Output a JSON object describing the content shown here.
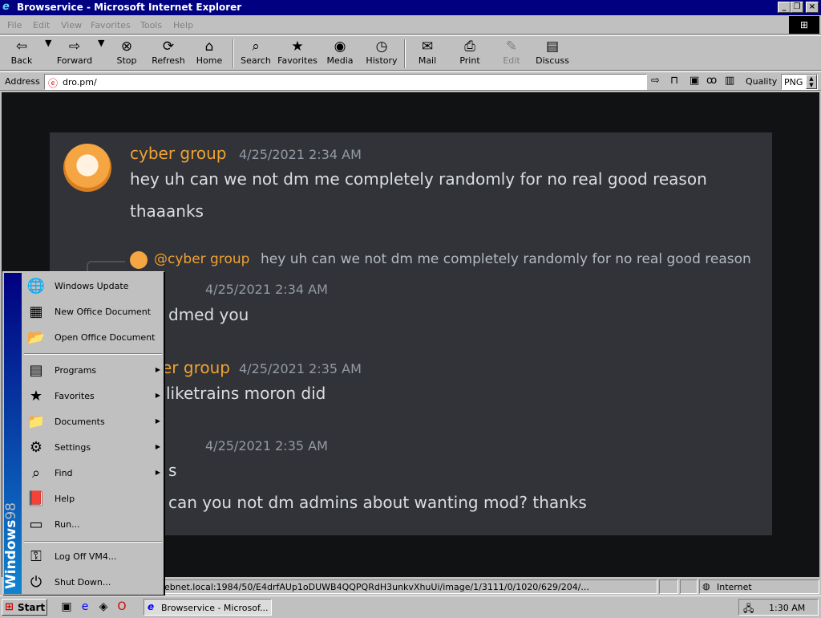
{
  "window": {
    "title": "Browservice - Microsoft Internet Explorer"
  },
  "menu": {
    "file": "File",
    "edit": "Edit",
    "view": "View",
    "favorites": "Favorites",
    "tools": "Tools",
    "help": "Help"
  },
  "toolbar": {
    "back": "Back",
    "forward": "Forward",
    "stop": "Stop",
    "refresh": "Refresh",
    "home": "Home",
    "search": "Search",
    "favorites": "Favorites",
    "media": "Media",
    "history": "History",
    "mail": "Mail",
    "print": "Print",
    "edit": "Edit",
    "discuss": "Discuss"
  },
  "address": {
    "label": "Address",
    "url": "dro.pm/",
    "quality_label": "Quality",
    "quality_value": "PNG"
  },
  "chat": {
    "msg1": {
      "author": "cyber group",
      "time": "4/25/2021 2:34 AM",
      "line1": "hey uh can we not dm me completely randomly for no real good reason",
      "line2": "thaaanks"
    },
    "reply": {
      "author": "@cyber group",
      "text": "hey uh can we not dm me completely randomly for no real good reason"
    },
    "msg2": {
      "time": "4/25/2021 2:34 AM",
      "text": "dmed you"
    },
    "msg3": {
      "author": "er group",
      "time": "4/25/2021 2:35 AM",
      "text": "liketrains moron did"
    },
    "msg4": {
      "time": "4/25/2021 2:35 AM",
      "line1": "s",
      "line2": "can you not dm admins about wanting mod? thanks"
    }
  },
  "status": {
    "text": "ebnet.local:1984/50/E4drfAUp1oDUWB4QQPQRdH3unkvXhuUi/image/1/3111/0/1020/629/204/...",
    "zone": "Internet"
  },
  "startmenu": {
    "brand_bold": "Windows",
    "brand_thin": "98",
    "items": [
      {
        "label": "Windows Update"
      },
      {
        "label": "New Office Document"
      },
      {
        "label": "Open Office Document"
      },
      {
        "label": "Programs"
      },
      {
        "label": "Favorites"
      },
      {
        "label": "Documents"
      },
      {
        "label": "Settings"
      },
      {
        "label": "Find"
      },
      {
        "label": "Help"
      },
      {
        "label": "Run..."
      },
      {
        "label": "Log Off VM4..."
      },
      {
        "label": "Shut Down..."
      }
    ]
  },
  "taskbar": {
    "start": "Start",
    "task": "Browservice - Microsof...",
    "clock": "1:30 AM"
  }
}
